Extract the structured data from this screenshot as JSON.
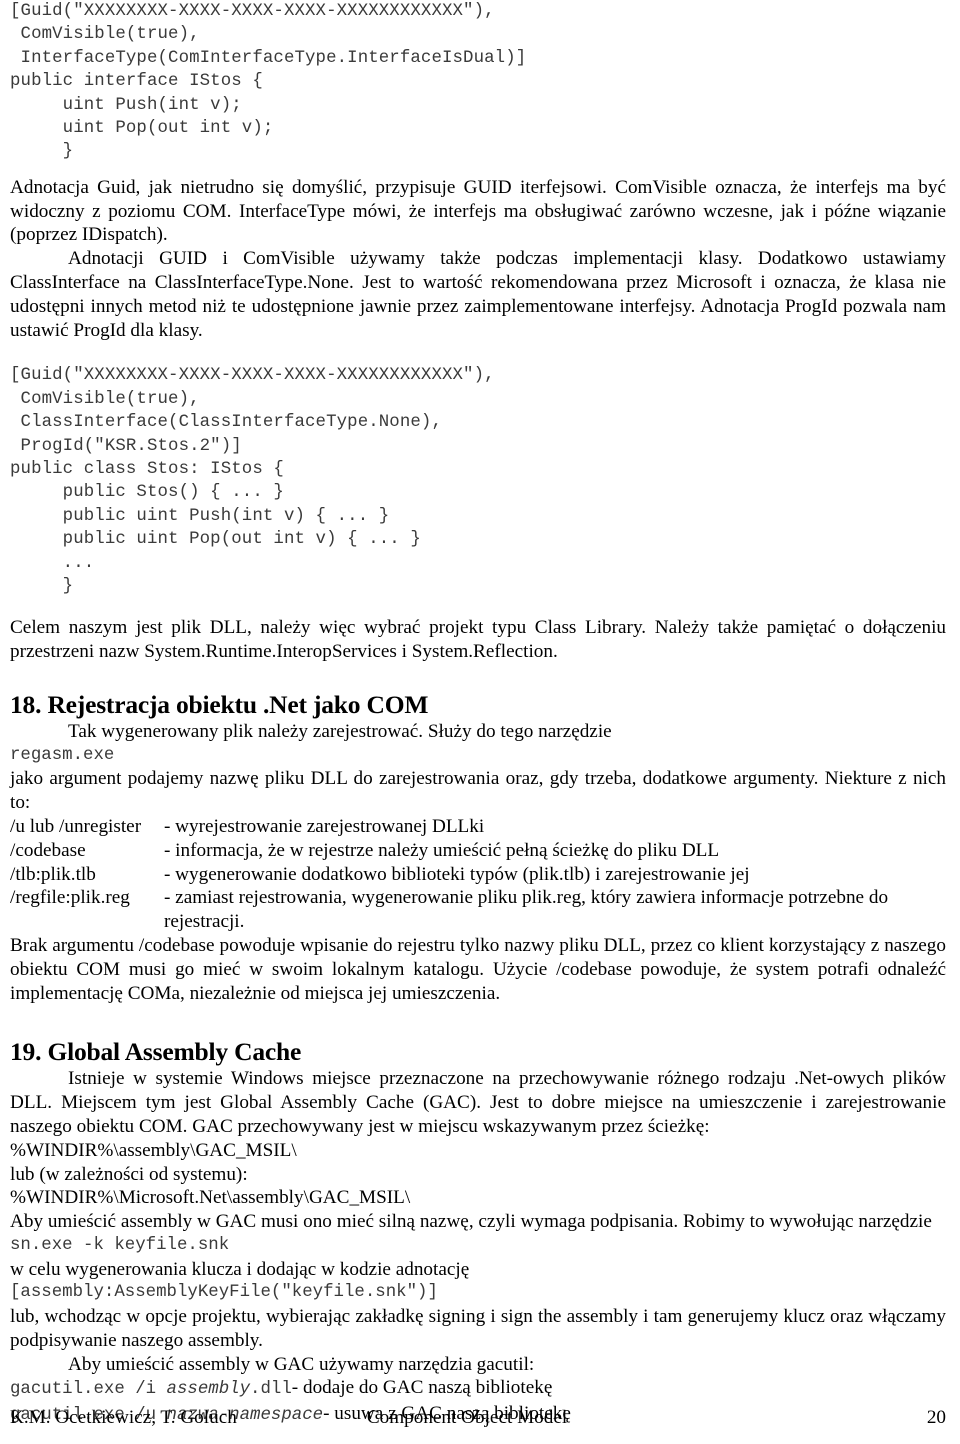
{
  "document": {
    "language": "pl",
    "page_number": "20"
  },
  "code_block_1": {
    "lines": [
      "[Guid(\"XXXXXXXX-XXXX-XXXX-XXXX-XXXXXXXXXXXX\"),",
      " ComVisible(true),",
      " InterfaceType(ComInterfaceType.InterfaceIsDual)]",
      "public interface IStos {",
      "     uint Push(int v);",
      "     uint Pop(out int v);",
      "     }"
    ]
  },
  "paragraph_1": "Adnotacja Guid, jak nietrudno się domyślić, przypisuje GUID iterfejsowi. ComVisible oznacza, że interfejs ma być widoczny z poziomu COM. InterfaceType mówi, że interfejs ma obsługiwać zarówno wczesne, jak i późne wiązanie (poprzez IDispatch).",
  "paragraph_2": "Adnotacji GUID i ComVisible używamy także podczas implementacji klasy. Dodatkowo ustawiamy ClassInterface na ClassInterfaceType.None. Jest to wartość rekomendowana przez Microsoft i oznacza, że klasa nie udostępni innych metod niż te udostępnione jawnie przez zaimplementowane interfejsy. Adnotacja ProgId pozwala nam ustawić ProgId dla klasy.",
  "code_block_2": {
    "lines": [
      "[Guid(\"XXXXXXXX-XXXX-XXXX-XXXX-XXXXXXXXXXXX\"),",
      " ComVisible(true),",
      " ClassInterface(ClassInterfaceType.None),",
      " ProgId(\"KSR.Stos.2\")]",
      "public class Stos: IStos {",
      "     public Stos() { ... }",
      "     public uint Push(int v) { ... }",
      "     public uint Pop(out int v) { ... }",
      "     ...",
      "     }"
    ]
  },
  "paragraph_3": "Celem naszym jest plik DLL, należy więc wybrać projekt typu Class Library. Należy także pamiętać o dołączeniu przestrzeni nazw System.Runtime.InteropServices i System.Reflection.",
  "section_18": {
    "heading": "18. Rejestracja obiektu .Net jako COM",
    "intro": "Tak wygenerowany plik należy zarejestrować. Służy do tego narzędzie",
    "tool_command": "regasm.exe",
    "after_tool": "jako argument podajemy nazwę pliku DLL do zarejestrowania oraz, gdy trzeba, dodatkowe argumenty. Niekture z nich to:",
    "switches": [
      {
        "key": "/u lub /unregister",
        "desc": "- wyrejestrowanie zarejestrowanej DLLki",
        "cont": ""
      },
      {
        "key": "/codebase",
        "desc": "- informacja, że w rejestrze należy umieścić pełną ścieżkę do pliku DLL",
        "cont": ""
      },
      {
        "key": "/tlb:plik.tlb",
        "desc": "- wygenerowanie dodatkowo biblioteki typów (plik.tlb) i zarejestrowanie jej",
        "cont": ""
      },
      {
        "key": "/regfile:plik.reg",
        "desc": "- zamiast rejestrowania, wygenerowanie pliku plik.reg, który zawiera informacje potrzebne do",
        "cont": "rejestracji."
      }
    ],
    "codebase_note": "Brak argumentu /codebase powoduje wpisanie do rejestru tylko nazwy pliku DLL, przez co klient korzystający z naszego obiektu COM musi go mieć w swoim lokalnym katalogu. Użycie /codebase powoduje, że system potrafi odnaleźć implementację COMa, niezależnie od miejsca jej umieszczenia."
  },
  "section_19": {
    "heading": "19. Global Assembly Cache",
    "intro": "Istnieje w systemie Windows miejsce przeznaczone na przechowywanie różnego rodzaju .Net-owych plików DLL. Miejscem tym jest Global Assembly Cache (GAC). Jest to dobre miejsce na umieszczenie i zarejestrowanie naszego obiektu COM. GAC przechowywany jest w miejscu wskazywanym przez ścieżkę:",
    "path_1": "%WINDIR%\\assembly\\GAC_MSIL\\",
    "path_alt_label": "lub (w zależności od systemu):",
    "path_2": "%WINDIR%\\Microsoft.Net\\assembly\\GAC_MSIL\\",
    "strong_name_note": "Aby umieścić assembly w GAC musi ono mieć silną nazwę, czyli wymaga podpisania. Robimy to wywołując narzędzie",
    "sn_command": "sn.exe -k keyfile.snk",
    "after_sn": "w celu wygenerowania klucza i dodając w kodzie adnotację",
    "assembly_attribute": "[assembly:AssemblyKeyFile(\"keyfile.snk\")]",
    "signing_note": "lub, wchodząc w opcje projektu, wybierając zakładkę signing i sign the assembly i tam generujemy klucz oraz włączamy podpisywanie naszego assembly.",
    "gacutil_intro": "Aby umieścić assembly w GAC używamy narzędzia gacutil:",
    "gacutil_rows": [
      {
        "cmd_pre": "gacutil.exe /i ",
        "cmd_italic": "assembly",
        "cmd_post": ".dll",
        "desc": "- dodaje do GAC naszą bibliotekę"
      },
      {
        "cmd_pre": "gacutil.exe /u ",
        "cmd_italic": "nazwa-namespace",
        "cmd_post": "",
        "desc": "- usuwa z GAC naszą bibliotekę"
      }
    ]
  },
  "footer": {
    "authors": "K.M. Ocetkiewicz, T. Goluch",
    "title": "Component Object Model",
    "page": "20"
  }
}
